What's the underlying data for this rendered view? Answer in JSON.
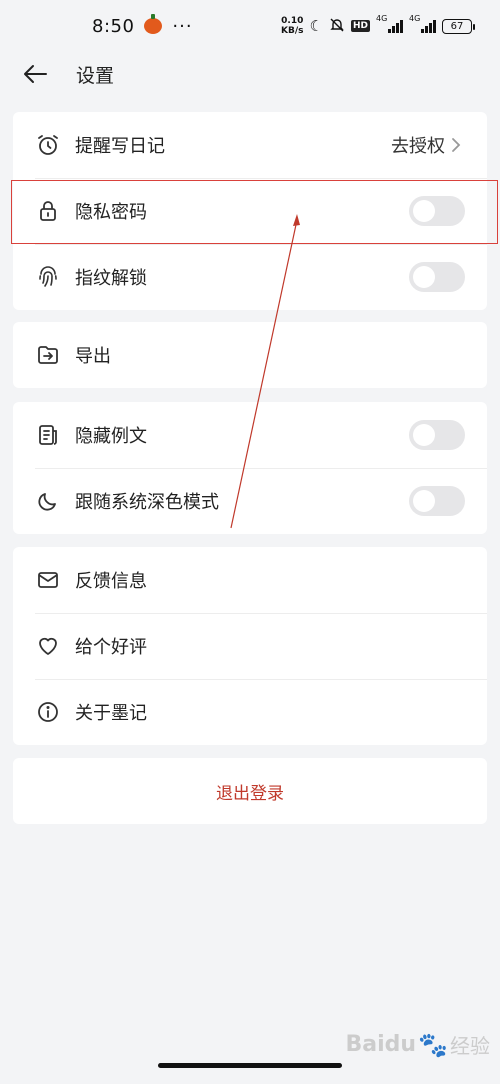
{
  "status_bar": {
    "time": "8:50",
    "dots": "···",
    "net_speed_value": "0.10",
    "net_speed_unit": "KB/s",
    "hd_badge": "HD",
    "signal_1": "4G",
    "signal_2": "4G",
    "battery": "67"
  },
  "header": {
    "title": "设置"
  },
  "sections": {
    "main": {
      "reminder_label": "提醒写日记",
      "reminder_value": "去授权",
      "privacy_label": "隐私密码",
      "fingerprint_label": "指纹解锁"
    },
    "export": {
      "export_label": "导出"
    },
    "display": {
      "hide_example_label": "隐藏例文",
      "dark_mode_label": "跟随系统深色模式"
    },
    "about": {
      "feedback_label": "反馈信息",
      "rate_label": "给个好评",
      "about_label": "关于墨记"
    }
  },
  "logout_label": "退出登录",
  "toggles": {
    "privacy": false,
    "fingerprint": false,
    "hide_example": false,
    "dark_mode": false
  },
  "colors": {
    "background": "#f3f4f6",
    "logout_text": "#c0392b",
    "highlight_border": "#d9413b",
    "toggle_off": "#e6e6e8"
  },
  "watermark": {
    "brand": "Baidu",
    "suffix": "经验"
  }
}
